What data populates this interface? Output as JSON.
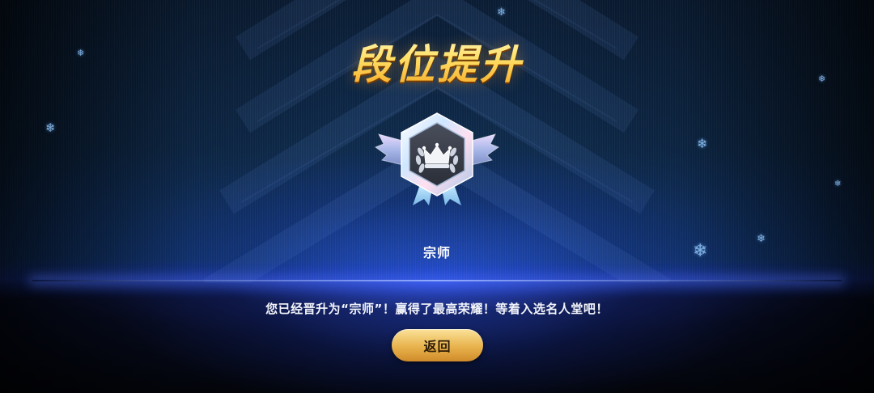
{
  "screen": {
    "title": "段位提升",
    "rank_name": "宗师",
    "message": "您已经晋升为“宗师”！赢得了最高荣耀！等着入选名人堂吧！",
    "back_button_label": "返回"
  },
  "badge": {
    "icon": "grandmaster-crown-badge-icon",
    "emblem": "crown-laurel-icon"
  },
  "decorations": {
    "snowflake_glyph": "❄"
  },
  "colors": {
    "title_gold": "#ffd84a",
    "button_gold": "#e8b24c",
    "accent_blue": "#3a5cff"
  }
}
